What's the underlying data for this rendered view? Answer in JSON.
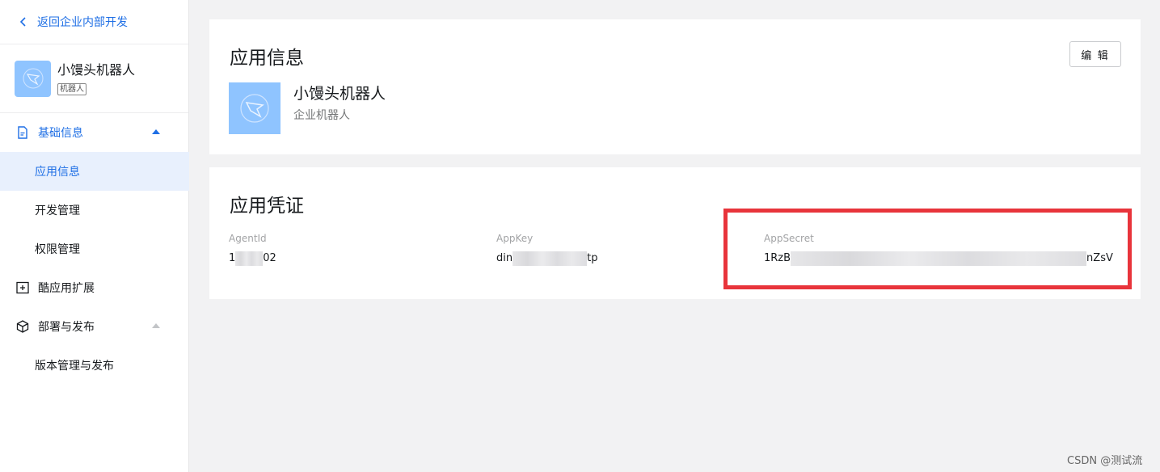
{
  "sidebar": {
    "back_label": "返回企业内部开发",
    "app_name": "小馒头机器人",
    "app_tag": "机器人",
    "groups": [
      {
        "label": "基础信息",
        "icon": "document-icon",
        "items": [
          "应用信息",
          "开发管理",
          "权限管理"
        ]
      },
      {
        "label": "酷应用扩展",
        "icon": "plus-box-icon"
      },
      {
        "label": "部署与发布",
        "icon": "cube-icon",
        "items": [
          "版本管理与发布"
        ]
      }
    ]
  },
  "app_info": {
    "title": "应用信息",
    "edit_label": "编 辑",
    "name": "小馒头机器人",
    "type": "企业机器人"
  },
  "credentials": {
    "title": "应用凭证",
    "agent_id": {
      "label": "AgentId",
      "prefix": "1",
      "suffix": "02"
    },
    "app_key": {
      "label": "AppKey",
      "prefix": "din",
      "suffix": "tp"
    },
    "app_secret": {
      "label": "AppSecret",
      "prefix": "1RzB",
      "suffix": "nZsV"
    }
  },
  "watermark": "CSDN @测试流",
  "colors": {
    "accent": "#1f6fe5",
    "highlight": "#e8343b",
    "logo_bg": "#8fc4ff"
  }
}
